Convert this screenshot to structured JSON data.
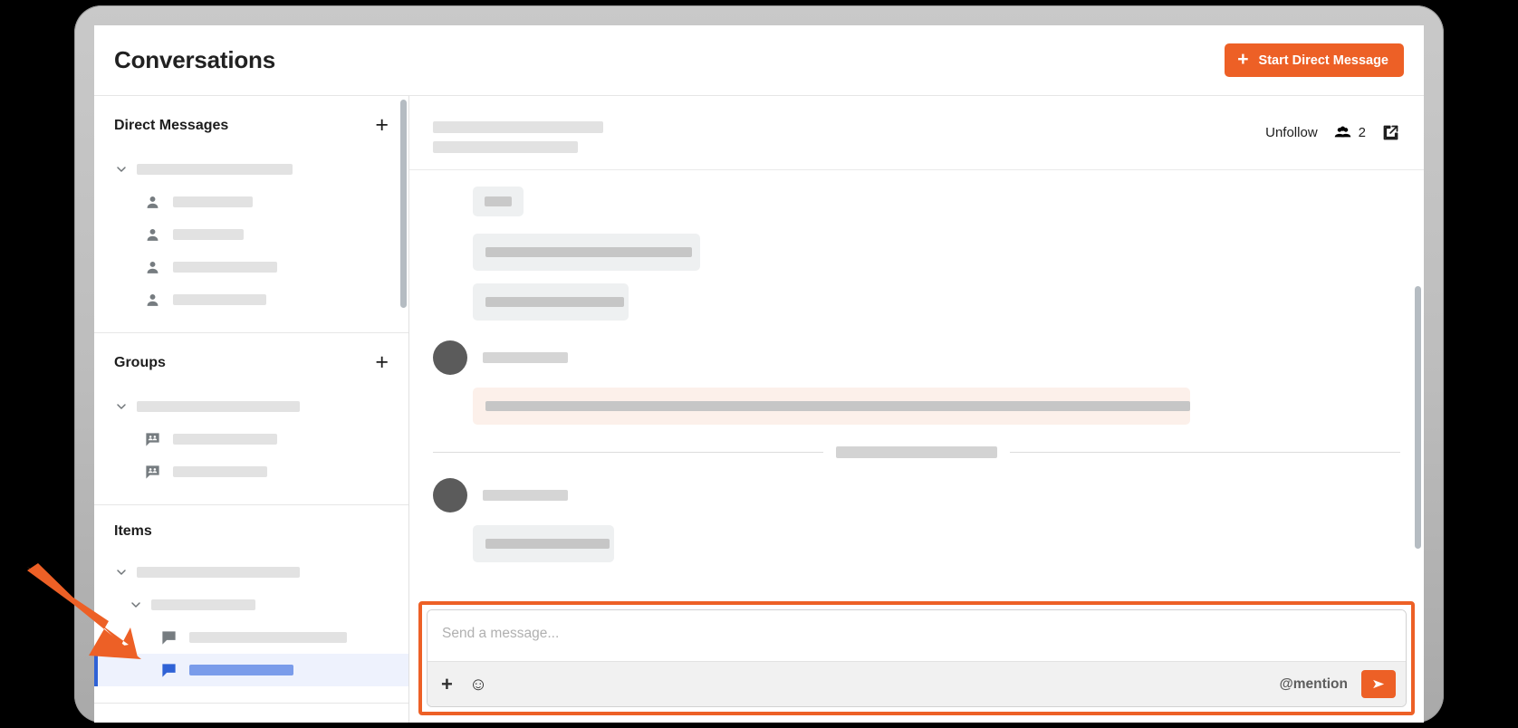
{
  "header": {
    "title": "Conversations",
    "start_dm_button": "Start Direct Message",
    "start_dm_icon": "plus-icon"
  },
  "sidebar": {
    "sections": [
      {
        "title": "Direct Messages",
        "add_icon": "plus-icon",
        "group_row": {
          "chevron": "chevron-down-icon",
          "placeholder_width": 172
        },
        "items": [
          {
            "icon": "person-icon",
            "placeholder_width": 88
          },
          {
            "icon": "person-icon",
            "placeholder_width": 78
          },
          {
            "icon": "person-icon",
            "placeholder_width": 115
          },
          {
            "icon": "person-icon",
            "placeholder_width": 103
          }
        ]
      },
      {
        "title": "Groups",
        "add_icon": "plus-icon",
        "group_row": {
          "chevron": "chevron-down-icon",
          "placeholder_width": 180
        },
        "items": [
          {
            "icon": "group-chat-icon",
            "placeholder_width": 115
          },
          {
            "icon": "group-chat-icon",
            "placeholder_width": 104
          }
        ]
      },
      {
        "title": "Items",
        "add_icon": "",
        "group_row": {
          "chevron": "chevron-down-icon",
          "placeholder_width": 180
        },
        "subgroup_row": {
          "chevron": "chevron-down-icon",
          "placeholder_width": 115
        },
        "items": [
          {
            "icon": "chat-icon",
            "placeholder_width": 174,
            "selected": false
          },
          {
            "icon": "chat-icon",
            "placeholder_width": 115,
            "selected": true
          }
        ]
      }
    ]
  },
  "conversation": {
    "title_placeholders": [
      188,
      160
    ],
    "actions": {
      "unfollow_label": "Unfollow",
      "members_icon": "people-group-icon",
      "members_count": "2",
      "open_external_icon": "external-link-icon"
    },
    "messages": [
      {
        "type": "chip",
        "placeholder_width": 30
      },
      {
        "type": "bubble",
        "placeholder_width": 228,
        "bubble_width": 251,
        "highlight": false
      },
      {
        "type": "bubble",
        "placeholder_width": 153,
        "bubble_width": 172,
        "highlight": false
      },
      {
        "type": "avatar-name",
        "avatar": "user-avatar",
        "name_placeholder_width": 94
      },
      {
        "type": "bubble",
        "placeholder_width": 778,
        "bubble_width": 792,
        "highlight": true
      },
      {
        "type": "divider",
        "chip_width": 178
      },
      {
        "type": "avatar-name",
        "avatar": "user-avatar",
        "name_placeholder_width": 94
      },
      {
        "type": "bubble",
        "placeholder_width": 137,
        "bubble_width": 156,
        "highlight": false
      }
    ]
  },
  "composer": {
    "placeholder": "Send a message...",
    "attach_icon": "plus-icon",
    "emoji_icon": "emoji-smiley-icon",
    "mention_label": "@mention",
    "send_icon": "send-paper-plane-icon",
    "highlight_color": "#ed6026"
  },
  "annotation": {
    "arrow_color": "#ed6026",
    "points_to": "selected-conversation-item"
  },
  "colors": {
    "accent": "#ed6026",
    "selected_blue": "#2f62d6",
    "selected_bg": "#eef2fd",
    "mention_bg": "#fcf0ea"
  }
}
